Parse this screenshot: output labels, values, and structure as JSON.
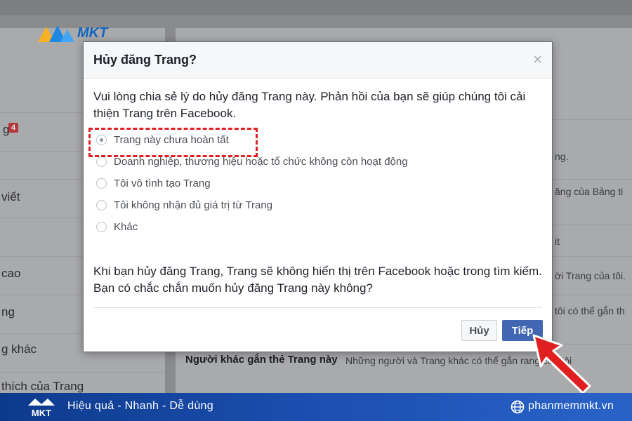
{
  "background": {
    "left_items": [
      {
        "label": "g",
        "badge": "4"
      },
      {
        "label": "viết"
      },
      {
        "label": "cao"
      },
      {
        "label": "ng"
      },
      {
        "label": "g khác"
      },
      {
        "label": "thích của Trang"
      }
    ],
    "right_texts": [
      "ng.",
      "ăng của Bảng ti",
      "it",
      "ời Trang của tôi.",
      "tôi có thể gắn th",
      "Những người và Trang khác có thể gắn   rang của tôi"
    ],
    "right_setting_label": "Người khác gắn thẻ Trang này"
  },
  "logo": {
    "text": "MKT"
  },
  "dialog": {
    "title": "Hủy đăng Trang?",
    "close_glyph": "×",
    "intro": "Vui lòng chia sẻ lý do hủy đăng Trang này. Phản hồi của bạn sẽ giúp chúng tôi cải thiện Trang trên Facebook.",
    "options": [
      "Trang này chưa hoàn tất",
      "Doanh nghiệp, thương hiệu hoặc tổ chức không còn hoạt động",
      "Tôi vô tình tạo Trang",
      "Tôi không nhận đủ giá trị từ Trang",
      "Khác"
    ],
    "selected_option": 0,
    "warning": "Khi bạn hủy đăng Trang, Trang sẽ không hiển thị trên Facebook hoặc trong tìm kiếm. Bạn có chắc chắn muốn hủy đăng Trang này không?",
    "cancel_label": "Hủy",
    "next_label": "Tiếp"
  },
  "banner": {
    "logo_text": "MKT",
    "slogan": "Hiệu quả - Nhanh - Dễ dùng",
    "website": "phanmemmkt.vn"
  },
  "colors": {
    "primary_button": "#4267b2",
    "highlight": "#e02020",
    "banner": "#1b4fb0"
  }
}
